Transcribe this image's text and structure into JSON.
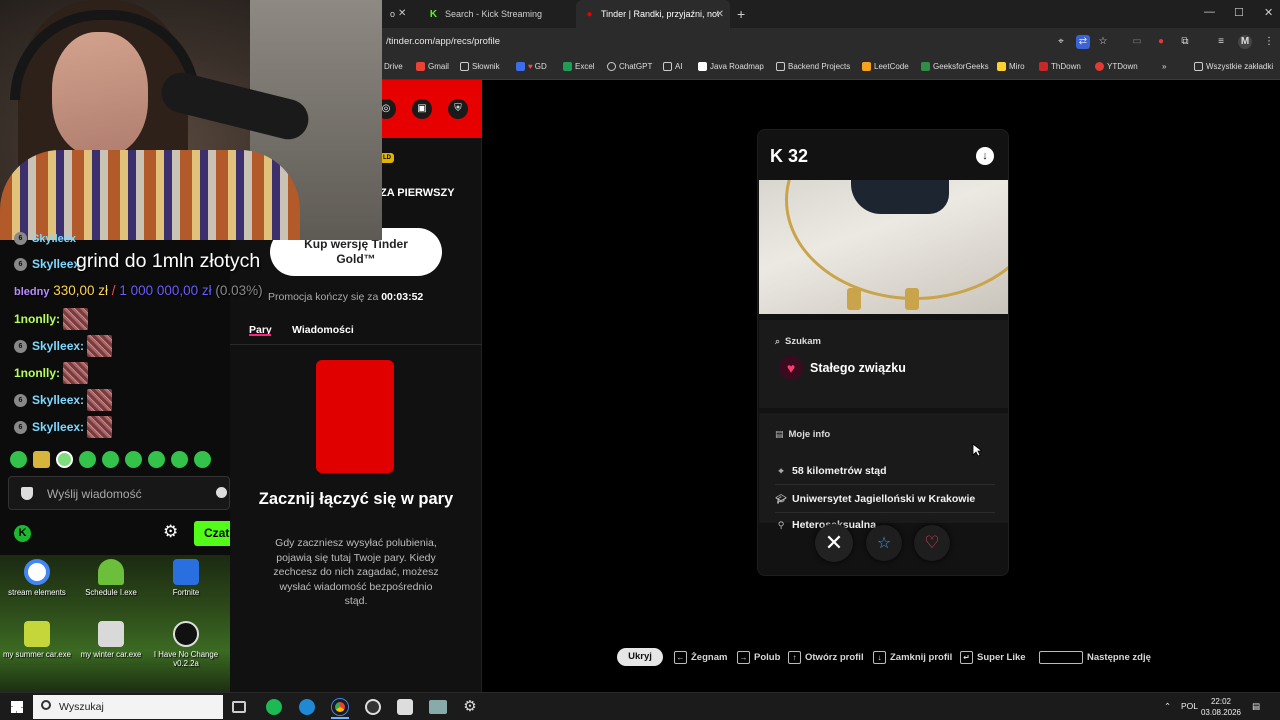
{
  "browser": {
    "tabs": [
      {
        "label": "Search - Kick Streaming",
        "active": false
      },
      {
        "label": "Tinder | Randki, przyjaźni, nowe",
        "active": true
      }
    ],
    "partial_tab_text": "o",
    "url": "/tinder.com/app/recs/profile",
    "bookmarks": [
      "Drive",
      "Gmail",
      "Słownik",
      "GD",
      "Excel",
      "ChatGPT",
      "AI",
      "Java Roadmap",
      "Backend Projects",
      "LeetCode",
      "GeeksforGeeks",
      "Miro",
      "ThDown",
      "YTDown"
    ],
    "all_bookmarks": "Wszystkie zakładki",
    "profile_initial": "M"
  },
  "tinder_sidebar": {
    "gold_badge": "LD",
    "gold_title": "ZA PIERWSZY",
    "gold_button": "Kup wersję Tinder Gold™",
    "promo_prefix": "Promocja kończy się za",
    "promo_time": "00:03:52",
    "tabs": [
      "Pary",
      "Wiadomości"
    ],
    "empty_title": "Zacznij łączyć się w pary",
    "empty_desc": "Gdy zaczniesz wysyłać polubienia, pojawią się tutaj Twoje pary. Kiedy zechcesz do nich zagadać, możesz wysłać wiadomość bezpośrednio stąd."
  },
  "profile": {
    "name_age": "K 32",
    "szukam_label": "Szukam",
    "szukam_value": "Stałego związku",
    "moje_info_label": "Moje info",
    "info": [
      {
        "icon": "location-icon",
        "text": "58 kilometrów stąd"
      },
      {
        "icon": "school-icon",
        "text": "Uniwersytet Jagielloński w Krakowie"
      },
      {
        "icon": "orientation-icon",
        "text": "Heteroseksualna"
      }
    ]
  },
  "key_hints": {
    "hide": "Ukryj",
    "items": [
      "Żegnam",
      "Polub",
      "Otwórz profil",
      "Zamknij profil",
      "Super Like",
      "Następne zdję"
    ]
  },
  "chat": {
    "partial_top": "Skylleex",
    "messages": [
      {
        "badge": "6",
        "user": "Skylleex",
        "color": "cyan",
        "suffix": ""
      },
      {
        "badge": "",
        "user": "1nonlly:",
        "color": "green",
        "suffix": ""
      },
      {
        "badge": "6",
        "user": "Skylleex:",
        "color": "cyan",
        "suffix": ""
      },
      {
        "badge": "",
        "user": "1nonlly:",
        "color": "green",
        "suffix": ""
      },
      {
        "badge": "6",
        "user": "Skylleex:",
        "color": "cyan",
        "suffix": ""
      },
      {
        "badge": "6",
        "user": "Skylleex:",
        "color": "cyan",
        "suffix": ""
      }
    ],
    "goal_text": "grind do 1mln złotych",
    "goal_user": "bledny",
    "goal_current": "330,00 zł",
    "goal_sep": "/",
    "goal_target": "1 000 000,00 zł",
    "goal_pct": "(0.03%)",
    "input_placeholder": "Wyślij wiadomość",
    "send_label": "Czat"
  },
  "desktop_icons": [
    {
      "label": "stream elements"
    },
    {
      "label": "Schedule I.exe"
    },
    {
      "label": "Fortnite"
    },
    {
      "label": "my summer car.exe"
    },
    {
      "label": "my winter car.exe"
    },
    {
      "label": "I Have No Change v0.2.2a"
    }
  ],
  "taskbar": {
    "search_placeholder": "Wyszukaj",
    "lang": "POL",
    "time": "22:02",
    "date": "03.08.2026"
  },
  "colors": {
    "tinder_red": "#e60000",
    "kick_green": "#53fc18",
    "tinder_pink": "#fd267a"
  }
}
